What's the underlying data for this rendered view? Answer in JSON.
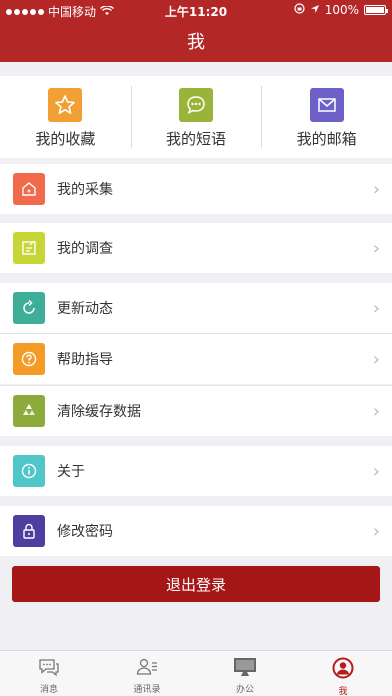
{
  "status_bar": {
    "carrier": "中国移动",
    "time": "上午11:20",
    "battery": "100%"
  },
  "header": {
    "title": "我"
  },
  "quick_actions": [
    {
      "label": "我的收藏",
      "icon": "star-icon",
      "color": "#f2a033"
    },
    {
      "label": "我的短语",
      "icon": "chat-bubble-icon",
      "color": "#9ab43a"
    },
    {
      "label": "我的邮箱",
      "icon": "mail-icon",
      "color": "#6e60c9"
    }
  ],
  "menu": [
    {
      "label": "我的采集",
      "icon": "home-icon",
      "color": "#f06a4b"
    },
    {
      "label": "我的调查",
      "icon": "edit-note-icon",
      "color": "#c7d636"
    },
    {
      "label": "更新动态",
      "icon": "refresh-icon",
      "color": "#3fae98"
    },
    {
      "label": "帮助指导",
      "icon": "question-icon",
      "color": "#f39a27"
    },
    {
      "label": "清除缓存数据",
      "icon": "recycle-icon",
      "color": "#8cab3c"
    },
    {
      "label": "关于",
      "icon": "info-icon",
      "color": "#4fc6c7"
    },
    {
      "label": "修改密码",
      "icon": "lock-icon",
      "color": "#4c3f9f"
    }
  ],
  "logout_label": "退出登录",
  "tabs": [
    {
      "label": "消息",
      "icon": "chat-icon"
    },
    {
      "label": "通讯录",
      "icon": "contacts-icon"
    },
    {
      "label": "办公",
      "icon": "monitor-icon"
    },
    {
      "label": "我",
      "icon": "profile-icon",
      "active": true
    }
  ],
  "colors": {
    "brand": "#b42727",
    "logout": "#a51616"
  }
}
